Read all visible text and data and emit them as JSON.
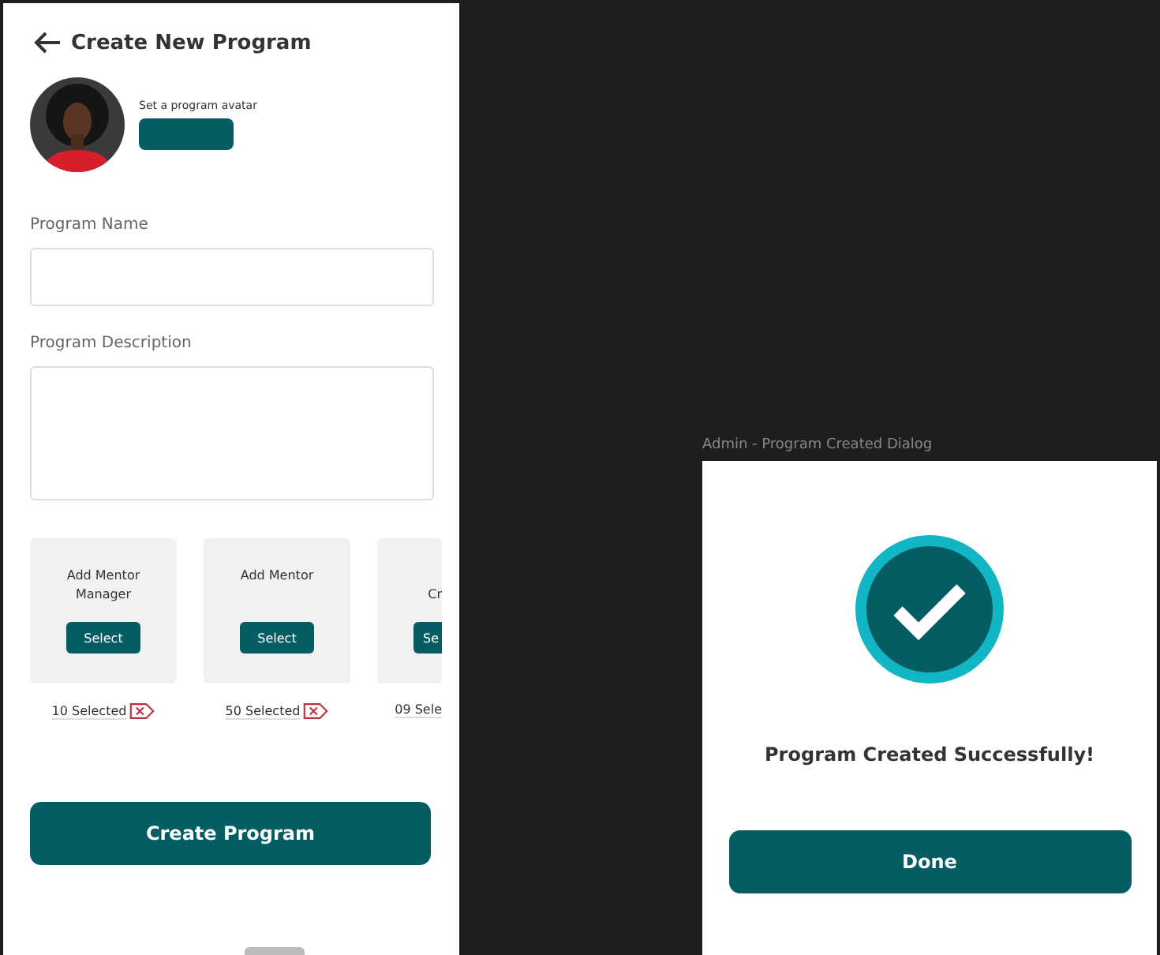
{
  "screen": {
    "title": "Create New Program",
    "avatar_label": "Set a program avatar",
    "fields": [
      {
        "label": "Program Name",
        "kind": "input"
      },
      {
        "label": "Program Description",
        "kind": "textarea"
      }
    ],
    "cards": [
      {
        "title": "Add Mentor Manager",
        "button": "Select",
        "count": "10 Selected",
        "clipped": false
      },
      {
        "title": "Add Mentor",
        "button": "Select",
        "count": "50 Selected",
        "clipped": false
      },
      {
        "title": "Cr",
        "button": "Se",
        "count": "09 Sele",
        "clipped": true
      }
    ],
    "submit": "Create Program"
  },
  "dialog": {
    "frame_label": "Admin - Program Created Dialog",
    "message": "Program Created Successfully!",
    "button": "Done"
  }
}
